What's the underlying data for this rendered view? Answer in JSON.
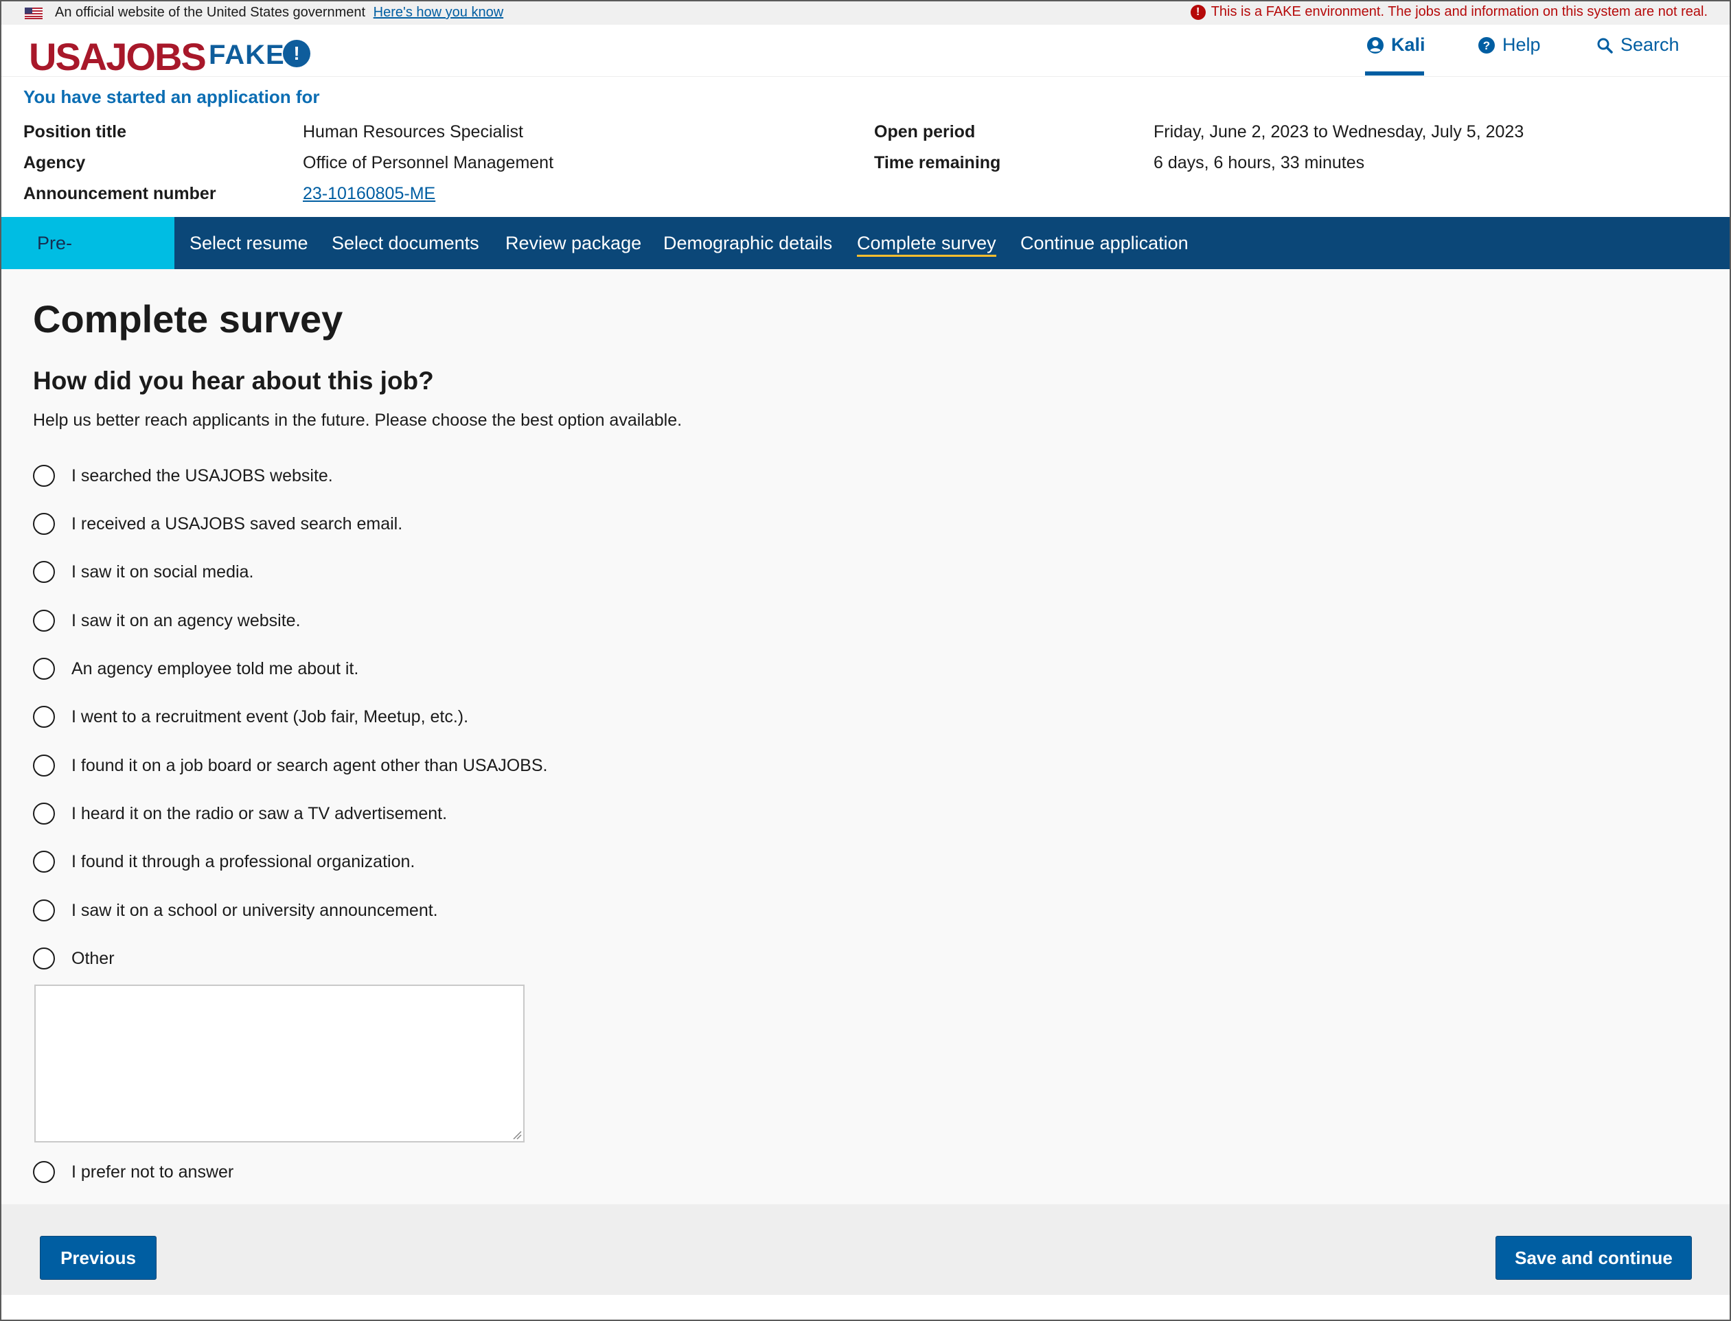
{
  "gov_banner": {
    "text": "An official website of the United States government",
    "link": "Here's how you know",
    "warning": "This is a FAKE environment. The jobs and information on this system are not real."
  },
  "header": {
    "logo": "USAJOBS",
    "fake_label": "FAKE",
    "user": "Kali",
    "help": "Help",
    "search": "Search"
  },
  "application": {
    "intro": "You have started an application for",
    "position_title_label": "Position title",
    "position_title": "Human Resources Specialist",
    "agency_label": "Agency",
    "agency": "Office of Personnel Management",
    "announcement_label": "Announcement number",
    "announcement": "23-10160805-ME",
    "open_period_label": "Open period",
    "open_period": "Friday, June 2, 2023 to Wednesday, July 5, 2023",
    "time_remaining_label": "Time remaining",
    "time_remaining": "6 days, 6 hours, 33 minutes"
  },
  "steps": [
    "Pre-application",
    "Select resume",
    "Select documents",
    "Review package",
    "Demographic details",
    "Complete survey",
    "Continue application"
  ],
  "main": {
    "title": "Complete survey",
    "question": "How did you hear about this job?",
    "help_text": "Help us better reach applicants in the future. Please choose the best option available.",
    "options": [
      "I searched the USAJOBS website.",
      "I received a USAJOBS saved search email.",
      "I saw it on social media.",
      "I saw it on an agency website.",
      "An agency employee told me about it.",
      "I went to a recruitment event (Job fair, Meetup, etc.).",
      "I found it on a job board or search agent other than USAJOBS.",
      "I heard it on the radio or saw a TV advertisement.",
      "I found it through a professional organization.",
      "I saw it on a school or university announcement.",
      "Other",
      "I prefer not to answer"
    ],
    "other_value": ""
  },
  "footer": {
    "previous": "Previous",
    "save": "Save and continue"
  },
  "colors": {
    "brand_red": "#a8182a",
    "primary_blue": "#005ea2",
    "nav_dark": "#0b4778",
    "nav_active": "#00bde3",
    "warning_red": "#b50909"
  }
}
